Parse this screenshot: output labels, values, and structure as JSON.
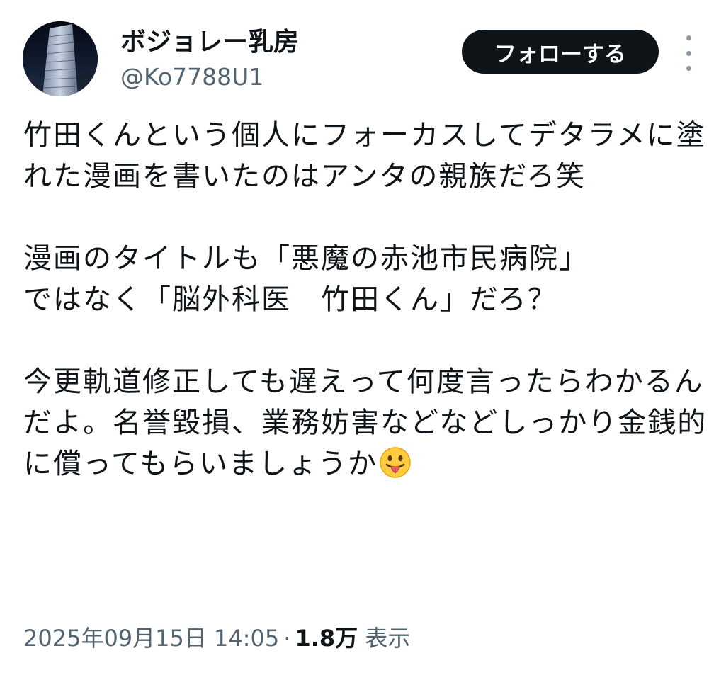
{
  "author": {
    "display_name": "ボジョレー乳房",
    "handle": "@Ko7788U1",
    "avatar_icon": "skyscraper-night-avatar"
  },
  "follow_label": "フォローする",
  "more_icon": "more-vertical-icon",
  "tweet": {
    "p1": "竹田くんという個人にフォーカスしてデタラメに塗れた漫画を書いたのはアンタの親族だろ笑",
    "p2_line1": "漫画のタイトルも「悪魔の赤池市民病院」",
    "p2_line2": "ではなく「脳外科医　竹田くん」だろ？",
    "p3": "今更軌道修正しても遅えって何度言ったらわかるんだよ。名誉毀損、業務妨害などなどしっかり金銭的に償ってもらいましょうか",
    "emoji": "face-with-tongue-emoji"
  },
  "meta": {
    "timestamp": "2025年09月15日 14:05",
    "separator": "·",
    "views_count": "1.8万",
    "views_label": "表示"
  },
  "colors": {
    "text_primary": "#0f1419",
    "text_secondary": "#536471",
    "button_bg": "#0f1419",
    "button_text": "#ffffff"
  }
}
